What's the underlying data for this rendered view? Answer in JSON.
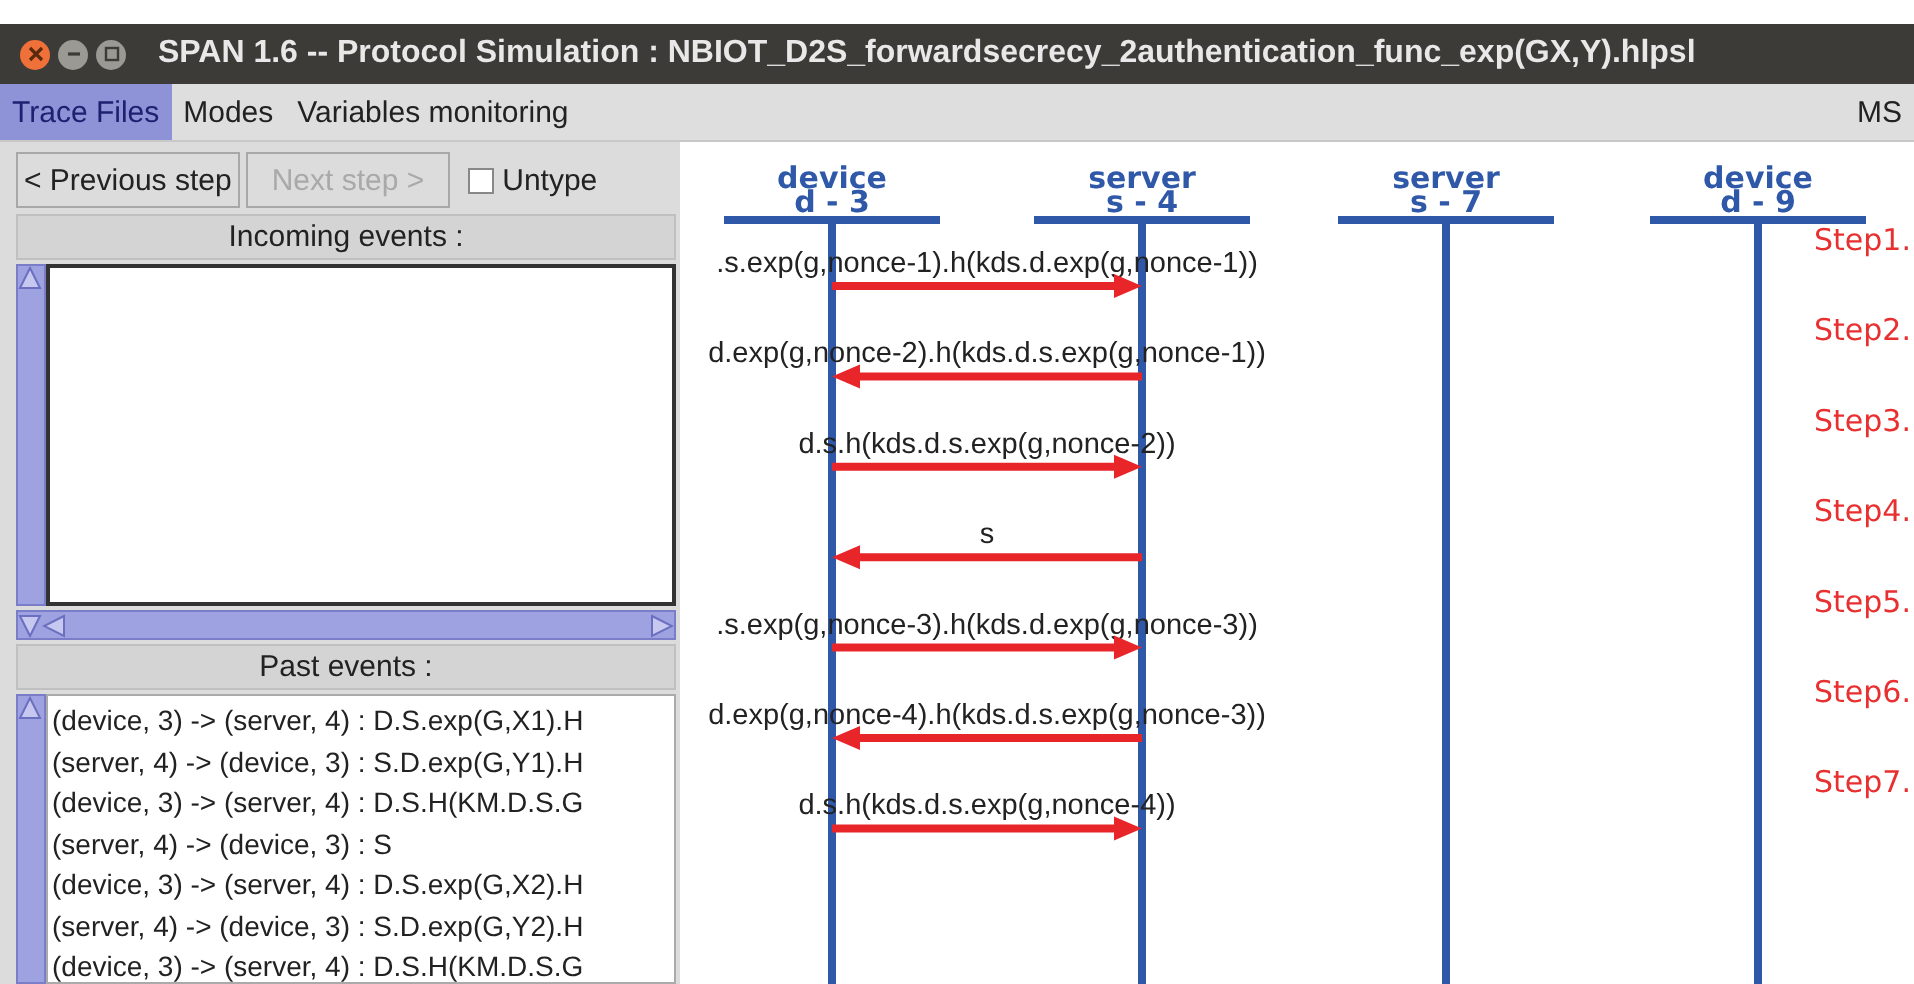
{
  "window": {
    "title": "SPAN 1.6 -- Protocol Simulation : NBIOT_D2S_forwardsecrecy_2authentication_func_exp(GX,Y).hlpsl"
  },
  "menu": [
    {
      "label": "Trace Files",
      "selected": true
    },
    {
      "label": "Modes",
      "selected": false
    },
    {
      "label": "Variables monitoring",
      "selected": false
    }
  ],
  "menu_right": "MS",
  "controls": {
    "buttons": [
      {
        "label": "< Previous step",
        "disabled": false
      },
      {
        "label": "Next step >",
        "disabled": true
      }
    ],
    "untype": {
      "label": "Untype",
      "checked": false
    }
  },
  "incoming_events": {
    "title": "Incoming events :"
  },
  "past_events": {
    "title": "Past events :",
    "items": [
      "(device, 3) -> (server, 4) : D.S.exp(G,X1).H",
      "(server, 4) -> (device, 3) : S.D.exp(G,Y1).H",
      "(device, 3) -> (server, 4) : D.S.H(KM.D.S.G",
      "(server, 4) -> (device, 3) : S",
      "(device, 3) -> (server, 4) : D.S.exp(G,X2).H",
      "(server, 4) -> (device, 3) : S.D.exp(G,Y2).H",
      "(device, 3) -> (server, 4) : D.S.H(KM.D.S.G"
    ]
  },
  "diagram": {
    "lifelines": [
      {
        "role": "device",
        "id": "d - 3"
      },
      {
        "role": "server",
        "id": "s - 4"
      },
      {
        "role": "server",
        "id": "s - 7"
      },
      {
        "role": "device",
        "id": "d - 9"
      }
    ],
    "messages": [
      {
        "kind": "forward",
        "label": ".s.exp(g,nonce-1).h(kds.d.exp(g,nonce-1))",
        "step": "Step1."
      },
      {
        "kind": "backward",
        "label": "d.exp(g,nonce-2).h(kds.d.s.exp(g,nonce-1))",
        "step": "Step2."
      },
      {
        "kind": "forward",
        "label": "d.s.h(kds.d.s.exp(g,nonce-2))",
        "step": "Step3."
      },
      {
        "kind": "backward",
        "label": "s",
        "step": "Step4."
      },
      {
        "kind": "forward",
        "label": ".s.exp(g,nonce-3).h(kds.d.exp(g,nonce-3))",
        "step": "Step5."
      },
      {
        "kind": "backward",
        "label": "d.exp(g,nonce-4).h(kds.d.s.exp(g,nonce-3))",
        "step": "Step6."
      },
      {
        "kind": "forward",
        "label": "d.s.h(kds.d.s.exp(g,nonce-4))",
        "step": "Step7."
      }
    ]
  }
}
